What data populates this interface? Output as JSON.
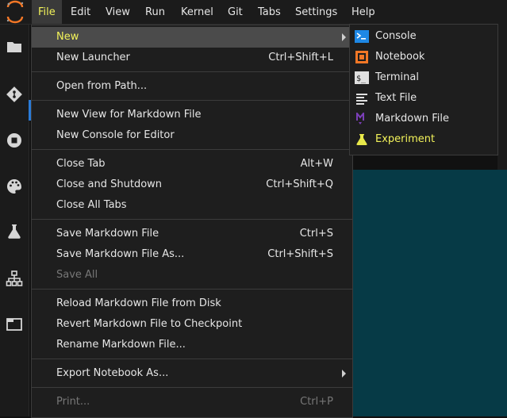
{
  "menubar": {
    "items": [
      {
        "label": "File"
      },
      {
        "label": "Edit"
      },
      {
        "label": "View"
      },
      {
        "label": "Run"
      },
      {
        "label": "Kernel"
      },
      {
        "label": "Git"
      },
      {
        "label": "Tabs"
      },
      {
        "label": "Settings"
      },
      {
        "label": "Help"
      }
    ]
  },
  "file_menu": {
    "new": {
      "label": "New"
    },
    "new_launcher": {
      "label": "New Launcher",
      "shortcut": "Ctrl+Shift+L"
    },
    "open_from_path": {
      "label": "Open from Path..."
    },
    "new_view_markdown": {
      "label": "New View for Markdown File"
    },
    "new_console_editor": {
      "label": "New Console for Editor"
    },
    "close_tab": {
      "label": "Close Tab",
      "shortcut": "Alt+W"
    },
    "close_shutdown": {
      "label": "Close and Shutdown",
      "shortcut": "Ctrl+Shift+Q"
    },
    "close_all_tabs": {
      "label": "Close All Tabs"
    },
    "save_markdown": {
      "label": "Save Markdown File",
      "shortcut": "Ctrl+S"
    },
    "save_markdown_as": {
      "label": "Save Markdown File As...",
      "shortcut": "Ctrl+Shift+S"
    },
    "save_all": {
      "label": "Save All"
    },
    "reload_markdown": {
      "label": "Reload Markdown File from Disk"
    },
    "revert_markdown": {
      "label": "Revert Markdown File to Checkpoint"
    },
    "rename_markdown": {
      "label": "Rename Markdown File..."
    },
    "export_notebook": {
      "label": "Export Notebook As..."
    },
    "print": {
      "label": "Print...",
      "shortcut": "Ctrl+P"
    }
  },
  "new_submenu": {
    "items": [
      {
        "label": "Console",
        "icon": "console-icon"
      },
      {
        "label": "Notebook",
        "icon": "notebook-icon"
      },
      {
        "label": "Terminal",
        "icon": "terminal-icon"
      },
      {
        "label": "Text File",
        "icon": "text-file-icon"
      },
      {
        "label": "Markdown File",
        "icon": "markdown-icon"
      },
      {
        "label": "Experiment",
        "icon": "flask-icon"
      }
    ]
  },
  "colors": {
    "highlight_text": "#f3f35a",
    "menu_bg": "#1e1e1e",
    "active_row": "#4b4b4b",
    "content_bg": "#063a46",
    "accent_blue": "#2a7bd8",
    "notebook_orange": "#f37726",
    "markdown_purple": "#7b3fb8"
  },
  "sidebar_icons": [
    "folder-icon",
    "git-icon",
    "stop-icon",
    "palette-icon",
    "flask-icon",
    "network-icon",
    "tab-icon"
  ]
}
